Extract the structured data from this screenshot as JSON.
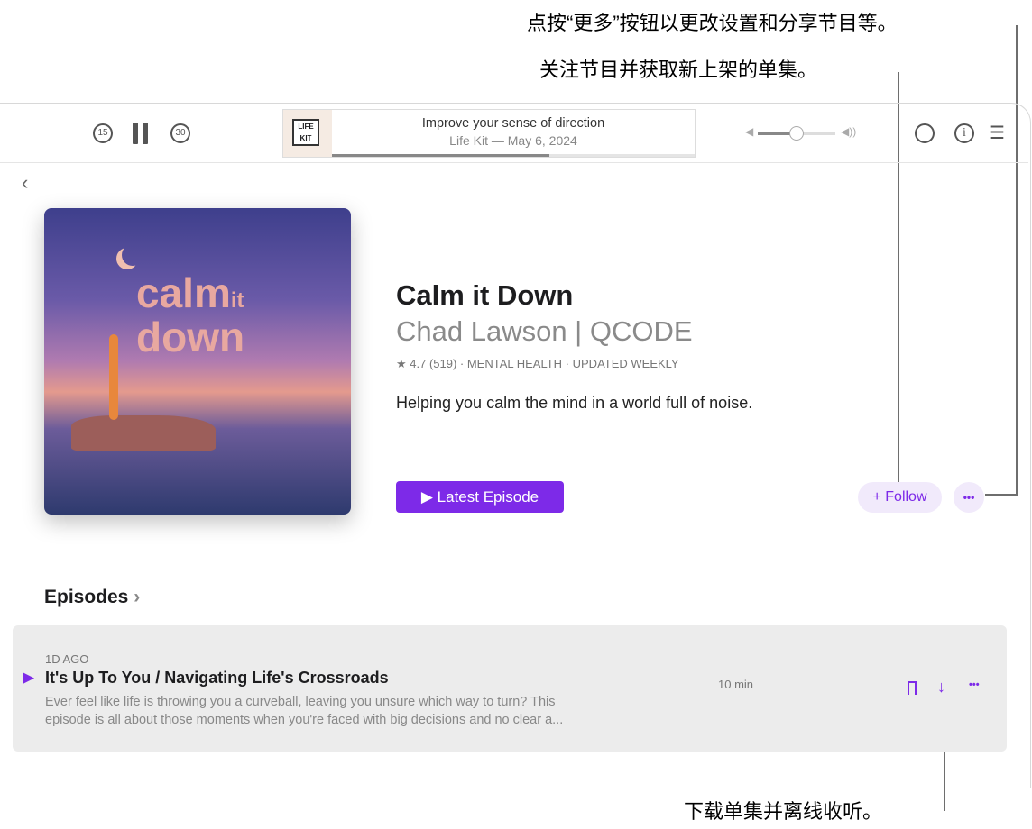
{
  "callouts": {
    "more": "点按“更多”按钮以更改设置和分享节目等。",
    "follow": "关注节目并获取新上架的单集。",
    "download": "下载单集并离线收听。"
  },
  "player": {
    "skip_back": "15",
    "skip_forward": "30",
    "now_playing_title": "Improve your sense of direction",
    "now_playing_subtitle": "Life Kit — May 6, 2024",
    "art_line1": "LIFE",
    "art_line2": "KIT",
    "progress": 0.6,
    "volume": 0.5
  },
  "show": {
    "art_title_1": "calm",
    "art_title_2": "it",
    "art_title_3": "down",
    "title": "Calm it Down",
    "author": "Chad Lawson | QCODE",
    "meta": "★ 4.7 (519) · MENTAL HEALTH · UPDATED WEEKLY",
    "description": "Helping you calm the mind in a world full of noise.",
    "latest_label": "▶ Latest Episode",
    "follow_label": "+ Follow",
    "more_label": "•••"
  },
  "episodes": {
    "heading": "Episodes",
    "chevron": "›",
    "items": [
      {
        "age": "1D AGO",
        "title": "It's Up To You / Navigating Life's Crossroads",
        "desc_line1": "Ever feel like life is throwing you a curveball, leaving you unsure which way to turn? This",
        "desc_line2": "episode is all about those moments when you're faced with big decisions and no clear a...",
        "duration": "10 min"
      }
    ]
  },
  "colors": {
    "accent": "#7d2ae8"
  }
}
